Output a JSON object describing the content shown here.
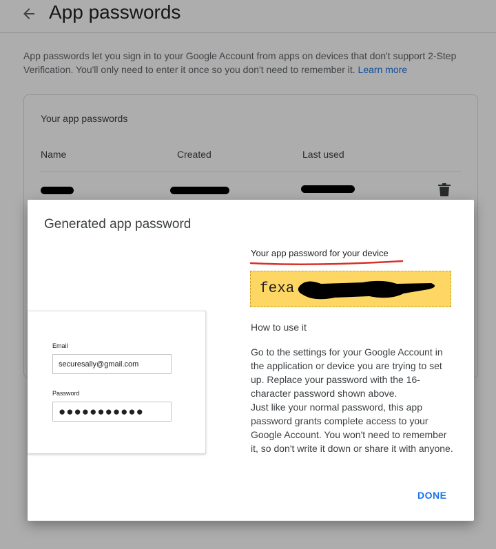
{
  "header": {
    "title": "App passwords"
  },
  "intro": {
    "text": "App passwords let you sign in to your Google Account from apps on devices that don't support 2-Step Verification. You'll only need to enter it once so you don't need to remember it.",
    "link": "Learn more"
  },
  "card": {
    "title": "Your app passwords",
    "columns": [
      "Name",
      "Created",
      "Last used"
    ]
  },
  "dialog": {
    "title": "Generated app password",
    "mock": {
      "email_label": "Email",
      "email_value": "securesally@gmail.com",
      "password_label": "Password",
      "password_value": "●●●●●●●●●●●"
    },
    "password_heading": "Your app password for your device",
    "password_visible": "fexa",
    "how_title": "How to use it",
    "how_p1": "Go to the settings for your Google Account in the application or device you are trying to set up. Replace your password with the 16-character password shown above.",
    "how_p2": "Just like your normal password, this app password grants complete access to your Google Account. You won't need to remember it, so don't write it down or share it with anyone.",
    "done_label": "DONE"
  },
  "colors": {
    "accent": "#1a73e8",
    "password_box": "#fdd663",
    "annotation_underline": "#d93025",
    "redaction": "#000000"
  }
}
